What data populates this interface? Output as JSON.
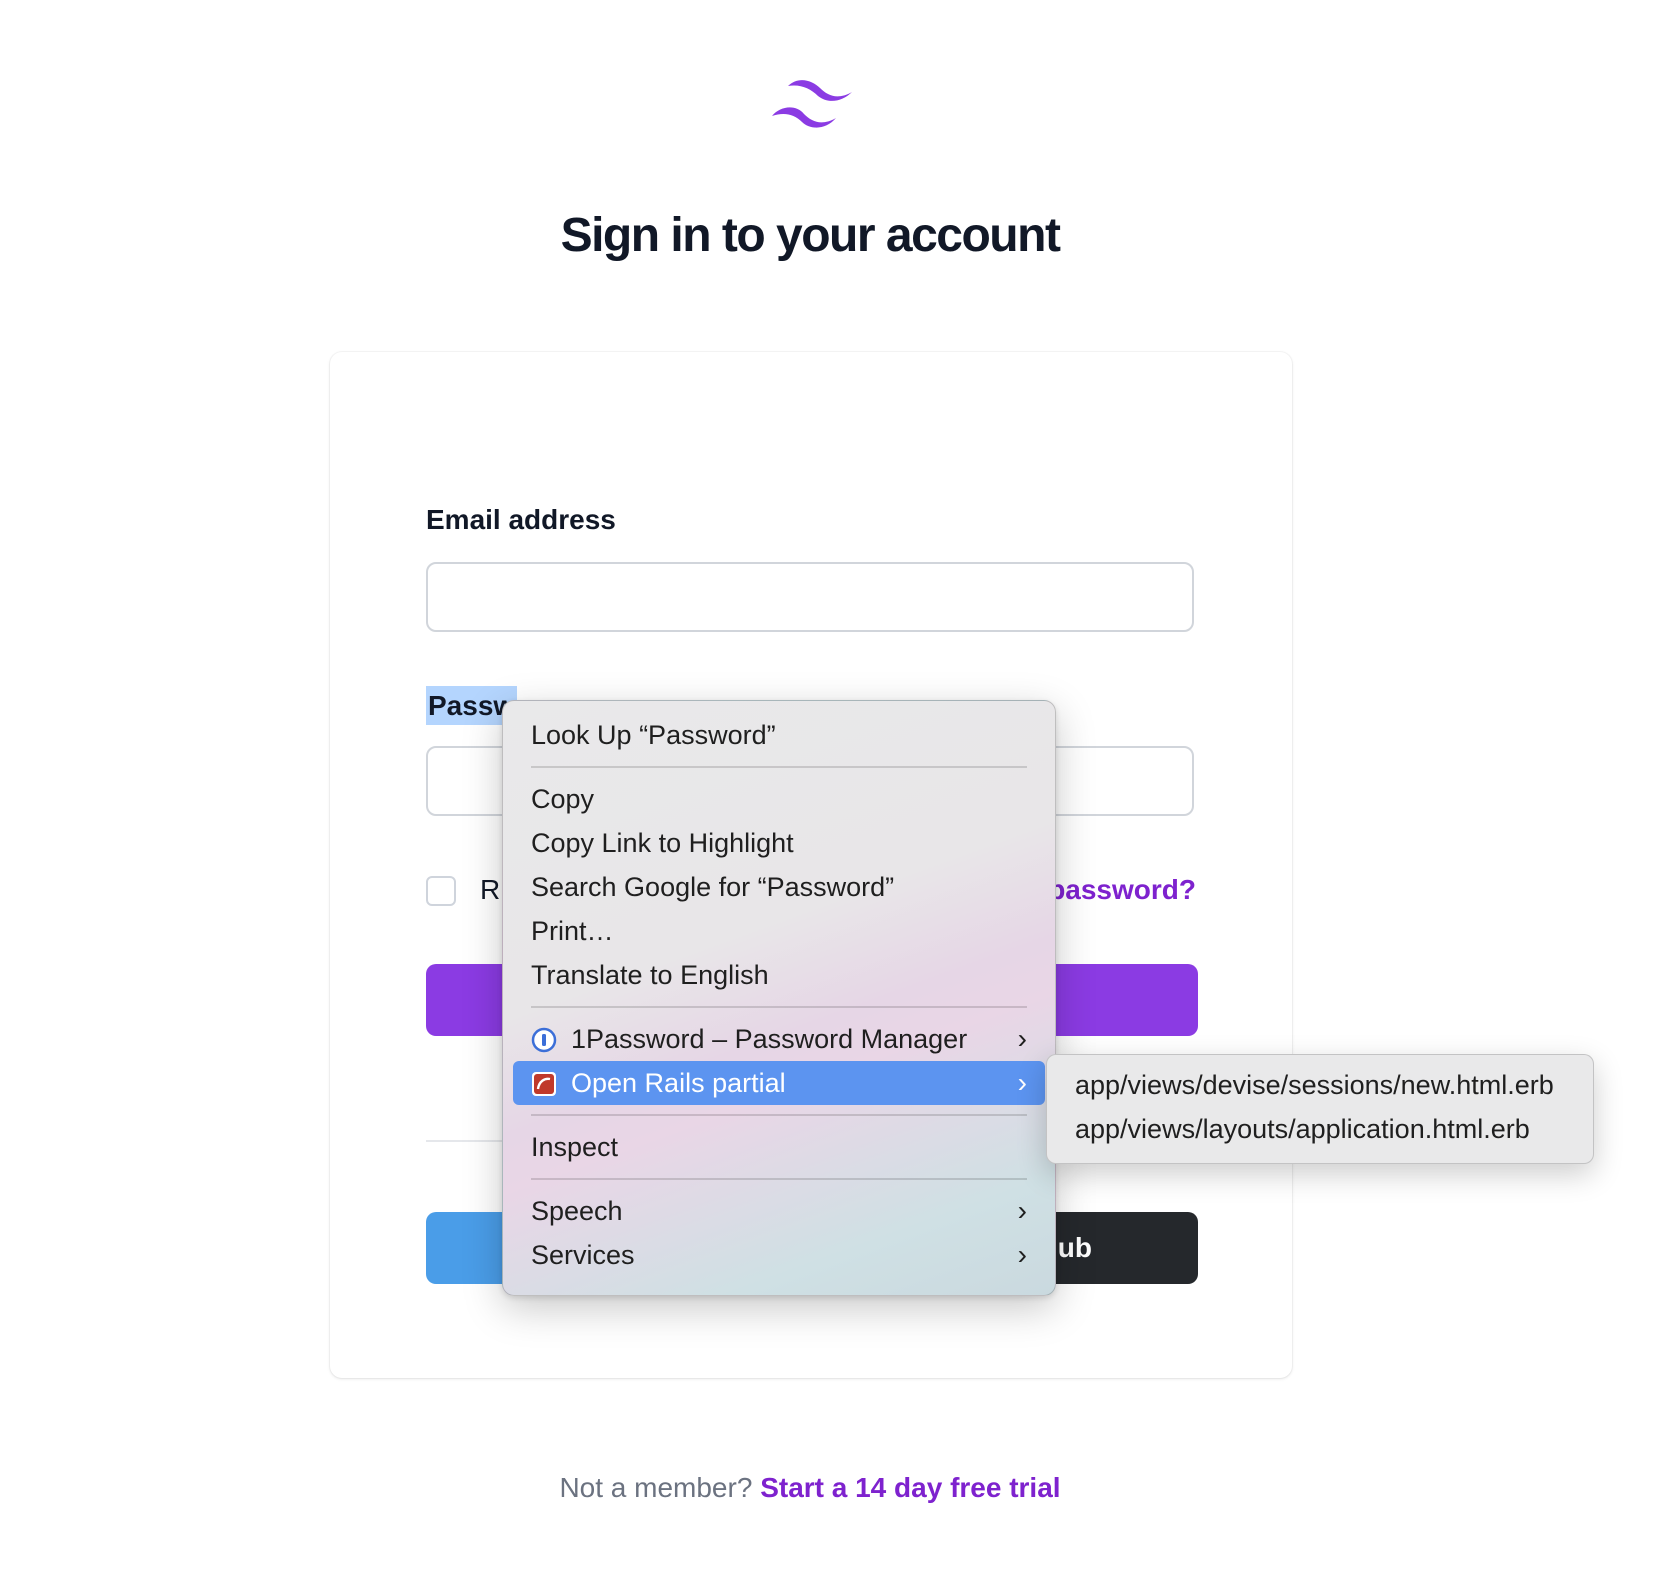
{
  "page": {
    "title": "Sign in to your account",
    "brand_color": "#8b3be3",
    "logo_icon": "tailwind-logo-icon"
  },
  "form": {
    "email_label": "Email address",
    "email_value": "",
    "password_label": "Password",
    "password_visible_label": "Passw",
    "password_value": "",
    "remember_label_visible": "R",
    "remember_checked": false,
    "forgot_link_visible": "password?"
  },
  "social": {
    "github_visible": "lub"
  },
  "footer": {
    "prompt": "Not a member?",
    "link": "Start a 14 day free trial"
  },
  "context_menu": {
    "look_up": "Look Up “Password”",
    "copy": "Copy",
    "copy_link": "Copy Link to Highlight",
    "search_google": "Search Google for “Password”",
    "print": "Print…",
    "translate": "Translate to English",
    "onepassword": "1Password – Password Manager",
    "open_rails": "Open Rails partial",
    "inspect": "Inspect",
    "speech": "Speech",
    "services": "Services",
    "arrow": "›"
  },
  "submenu": {
    "items": [
      "app/views/devise/sessions/new.html.erb",
      "app/views/layouts/application.html.erb"
    ]
  }
}
